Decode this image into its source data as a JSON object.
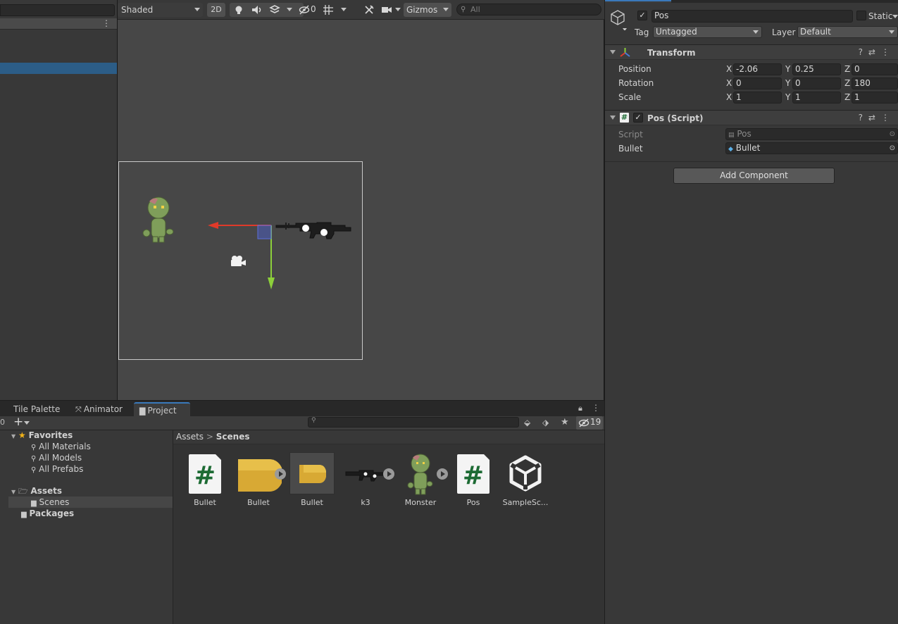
{
  "scene_toolbar": {
    "shading_mode": "Shaded",
    "mode_2d": "2D",
    "hidden_count": "0",
    "gizmos": "Gizmos",
    "search_placeholder": "All"
  },
  "bottom_tabs": [
    {
      "label": "Tile Palette"
    },
    {
      "label": "Animator"
    },
    {
      "label": "Project"
    }
  ],
  "project": {
    "hidden_count": "19",
    "tree": {
      "favorites": "Favorites",
      "all_materials": "All Materials",
      "all_models": "All Models",
      "all_prefabs": "All Prefabs",
      "assets": "Assets",
      "scenes": "Scenes",
      "packages": "Packages"
    },
    "breadcrumb": {
      "root": "Assets",
      "separator": ">",
      "current": "Scenes"
    },
    "assets": [
      {
        "label": "Bullet",
        "type": "script"
      },
      {
        "label": "Bullet",
        "type": "sprite-sheet"
      },
      {
        "label": "Bullet",
        "type": "prefab"
      },
      {
        "label": "k3",
        "type": "sprite-sheet"
      },
      {
        "label": "Monster",
        "type": "sprite-sheet"
      },
      {
        "label": "Pos",
        "type": "script"
      },
      {
        "label": "SampleSc...",
        "type": "scene"
      }
    ]
  },
  "inspector": {
    "object_name": "Pos",
    "static_label": "Static",
    "tag_label": "Tag",
    "tag_value": "Untagged",
    "layer_label": "Layer",
    "layer_value": "Default",
    "transform": {
      "title": "Transform",
      "position_label": "Position",
      "rotation_label": "Rotation",
      "scale_label": "Scale",
      "position": {
        "x": "-2.06",
        "y": "0.25",
        "z": "0"
      },
      "rotation": {
        "x": "0",
        "y": "0",
        "z": "180"
      },
      "scale": {
        "x": "1",
        "y": "1",
        "z": "1"
      },
      "axis_x": "X",
      "axis_y": "Y",
      "axis_z": "Z"
    },
    "script_component": {
      "title": "Pos (Script)",
      "script_label": "Script",
      "script_value": "Pos",
      "bullet_label": "Bullet",
      "bullet_value": "Bullet"
    },
    "add_component": "Add Component"
  },
  "colors": {
    "selection_blue": "#2c5d87",
    "tab_accent": "#3a79bb",
    "gizmo_x": "#e03a2a",
    "gizmo_y": "#8ccf3a",
    "script_green": "#1d6b34",
    "bullet_yellow": "#d8a934"
  }
}
